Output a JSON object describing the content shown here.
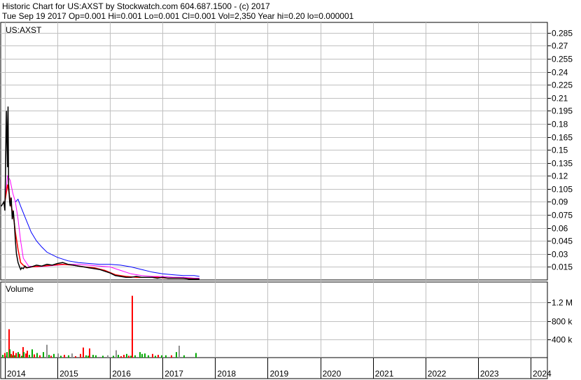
{
  "header": {
    "line1": "Historic Chart for US:AXST by Stockwatch.com 604.687.1500 - (c) 2017",
    "line2": "Tue Sep 19 2017   Op=0.001   Hi=0.001   Lo=0.001   Cl=0.001   Vol=2,350   Year hi=0.20   lo=0.000001"
  },
  "chart_data": {
    "type": "line",
    "symbol": "US:AXST",
    "price_axis": {
      "ticks": [
        "0.285",
        "0.27",
        "0.255",
        "0.24",
        "0.225",
        "0.21",
        "0.195",
        "0.18",
        "0.165",
        "0.15",
        "0.135",
        "0.12",
        "0.105",
        "0.09",
        "0.075",
        "0.06",
        "0.045",
        "0.03",
        "0.015"
      ],
      "ylim": [
        0,
        0.297
      ]
    },
    "volume_panel": {
      "title": "Volume",
      "ticks": [
        "1.2 M",
        "800 k",
        "400 k"
      ],
      "ylim": [
        0,
        1.65
      ]
    },
    "x_axis": {
      "labels": [
        "2014",
        "2015",
        "2016",
        "2017",
        "2018",
        "2019",
        "2020",
        "2021",
        "2022",
        "2023",
        "2024"
      ],
      "xlim": [
        2013.92,
        2024.32
      ]
    },
    "grid": true,
    "colors": {
      "price": "#000000",
      "ma_short": "#ff0000",
      "ma_mid": "#ff00ff",
      "ma_long": "#0000ff",
      "vol_up": "#00aa00",
      "vol_down": "#ff0000",
      "vol_flat": "#909090"
    },
    "price": {
      "x": [
        2013.93,
        2013.98,
        2014.0,
        2014.03,
        2014.05,
        2014.06,
        2014.07,
        2014.09,
        2014.1,
        2014.12,
        2014.14,
        2014.16,
        2014.18,
        2014.2,
        2014.22,
        2014.25,
        2014.28,
        2014.3,
        2014.32,
        2014.35,
        2014.38,
        2014.42,
        2014.5,
        2014.6,
        2014.7,
        2014.8,
        2014.9,
        2015.0,
        2015.1,
        2015.2,
        2015.3,
        2015.4,
        2015.5,
        2015.6,
        2015.7,
        2015.8,
        2015.9,
        2016.0,
        2016.1,
        2016.2,
        2016.3,
        2016.4,
        2016.5,
        2016.6,
        2016.7,
        2016.8,
        2016.9,
        2017.0,
        2017.1,
        2017.2,
        2017.3,
        2017.4,
        2017.5,
        2017.6,
        2017.7
      ],
      "y": [
        0.085,
        0.09,
        0.08,
        0.195,
        0.13,
        0.2,
        0.11,
        0.09,
        0.085,
        0.095,
        0.07,
        0.08,
        0.065,
        0.045,
        0.03,
        0.02,
        0.015,
        0.012,
        0.014,
        0.013,
        0.016,
        0.014,
        0.015,
        0.017,
        0.016,
        0.018,
        0.017,
        0.019,
        0.02,
        0.018,
        0.017,
        0.016,
        0.015,
        0.014,
        0.013,
        0.012,
        0.01,
        0.008,
        0.005,
        0.004,
        0.003,
        0.003,
        0.004,
        0.003,
        0.003,
        0.003,
        0.002,
        0.003,
        0.002,
        0.002,
        0.002,
        0.002,
        0.001,
        0.001,
        0.001
      ]
    },
    "ma_short": {
      "x": [
        2014.0,
        2014.05,
        2014.08,
        2014.12,
        2014.16,
        2014.2,
        2014.25,
        2014.3,
        2014.4,
        2014.5,
        2014.7,
        2014.9,
        2015.1,
        2015.3,
        2015.5,
        2015.7,
        2015.9,
        2016.1,
        2016.3,
        2016.5,
        2016.7,
        2016.9,
        2017.1,
        2017.3,
        2017.5,
        2017.7
      ],
      "y": [
        0.09,
        0.11,
        0.1,
        0.085,
        0.075,
        0.055,
        0.035,
        0.02,
        0.014,
        0.015,
        0.016,
        0.017,
        0.018,
        0.017,
        0.015,
        0.014,
        0.011,
        0.006,
        0.004,
        0.003,
        0.003,
        0.003,
        0.002,
        0.002,
        0.0015,
        0.001
      ]
    },
    "ma_mid": {
      "x": [
        2014.0,
        2014.05,
        2014.1,
        2014.15,
        2014.2,
        2014.25,
        2014.3,
        2014.35,
        2014.45,
        2014.6,
        2014.8,
        2015.0,
        2015.2,
        2015.4,
        2015.6,
        2015.8,
        2016.0,
        2016.2,
        2016.4,
        2016.6,
        2016.8,
        2017.0,
        2017.2,
        2017.4,
        2017.6,
        2017.7
      ],
      "y": [
        0.09,
        0.12,
        0.115,
        0.1,
        0.09,
        0.07,
        0.045,
        0.025,
        0.016,
        0.015,
        0.016,
        0.017,
        0.018,
        0.018,
        0.017,
        0.016,
        0.015,
        0.011,
        0.007,
        0.005,
        0.004,
        0.004,
        0.003,
        0.003,
        0.002,
        0.002
      ]
    },
    "ma_long": {
      "x": [
        2014.2,
        2014.25,
        2014.3,
        2014.4,
        2014.5,
        2014.6,
        2014.7,
        2014.8,
        2015.0,
        2015.2,
        2015.4,
        2015.6,
        2015.8,
        2016.0,
        2016.2,
        2016.4,
        2016.6,
        2016.8,
        2017.0,
        2017.2,
        2017.4,
        2017.6,
        2017.7
      ],
      "y": [
        0.09,
        0.093,
        0.085,
        0.07,
        0.055,
        0.045,
        0.038,
        0.032,
        0.026,
        0.022,
        0.02,
        0.019,
        0.018,
        0.018,
        0.017,
        0.015,
        0.012,
        0.009,
        0.007,
        0.006,
        0.005,
        0.005,
        0.004
      ]
    },
    "volume_bars": [
      {
        "x": 2013.95,
        "v": 0.06,
        "c": "up"
      },
      {
        "x": 2013.98,
        "v": 0.1,
        "c": "down"
      },
      {
        "x": 2014.01,
        "v": 0.04,
        "c": "flat"
      },
      {
        "x": 2014.03,
        "v": 0.12,
        "c": "up"
      },
      {
        "x": 2014.06,
        "v": 0.62,
        "c": "down"
      },
      {
        "x": 2014.08,
        "v": 0.18,
        "c": "up"
      },
      {
        "x": 2014.1,
        "v": 0.08,
        "c": "down"
      },
      {
        "x": 2014.13,
        "v": 0.05,
        "c": "up"
      },
      {
        "x": 2014.15,
        "v": 0.14,
        "c": "down"
      },
      {
        "x": 2014.17,
        "v": 0.05,
        "c": "up"
      },
      {
        "x": 2014.2,
        "v": 0.1,
        "c": "down"
      },
      {
        "x": 2014.24,
        "v": 0.12,
        "c": "up"
      },
      {
        "x": 2014.27,
        "v": 0.08,
        "c": "down"
      },
      {
        "x": 2014.3,
        "v": 0.04,
        "c": "up"
      },
      {
        "x": 2014.33,
        "v": 0.23,
        "c": "down"
      },
      {
        "x": 2014.35,
        "v": 0.12,
        "c": "up"
      },
      {
        "x": 2014.38,
        "v": 0.09,
        "c": "down"
      },
      {
        "x": 2014.41,
        "v": 0.15,
        "c": "down"
      },
      {
        "x": 2014.45,
        "v": 0.06,
        "c": "up"
      },
      {
        "x": 2014.5,
        "v": 0.18,
        "c": "up"
      },
      {
        "x": 2014.55,
        "v": 0.07,
        "c": "down"
      },
      {
        "x": 2014.6,
        "v": 0.1,
        "c": "up"
      },
      {
        "x": 2014.65,
        "v": 0.05,
        "c": "down"
      },
      {
        "x": 2014.72,
        "v": 0.12,
        "c": "up"
      },
      {
        "x": 2014.78,
        "v": 0.28,
        "c": "flat"
      },
      {
        "x": 2014.83,
        "v": 0.06,
        "c": "up"
      },
      {
        "x": 2014.87,
        "v": 0.04,
        "c": "down"
      },
      {
        "x": 2014.92,
        "v": 0.08,
        "c": "up"
      },
      {
        "x": 2015.0,
        "v": 0.09,
        "c": "flat"
      },
      {
        "x": 2015.05,
        "v": 0.04,
        "c": "up"
      },
      {
        "x": 2015.12,
        "v": 0.06,
        "c": "down"
      },
      {
        "x": 2015.2,
        "v": 0.05,
        "c": "up"
      },
      {
        "x": 2015.27,
        "v": 0.09,
        "c": "flat"
      },
      {
        "x": 2015.33,
        "v": 0.03,
        "c": "down"
      },
      {
        "x": 2015.43,
        "v": 0.08,
        "c": "down"
      },
      {
        "x": 2015.48,
        "v": 0.22,
        "c": "down"
      },
      {
        "x": 2015.53,
        "v": 0.05,
        "c": "up"
      },
      {
        "x": 2015.57,
        "v": 0.04,
        "c": "up"
      },
      {
        "x": 2015.6,
        "v": 0.2,
        "c": "down"
      },
      {
        "x": 2015.66,
        "v": 0.06,
        "c": "up"
      },
      {
        "x": 2015.72,
        "v": 0.05,
        "c": "up"
      },
      {
        "x": 2015.85,
        "v": 0.04,
        "c": "up"
      },
      {
        "x": 2015.95,
        "v": 0.05,
        "c": "flat"
      },
      {
        "x": 2016.05,
        "v": 0.04,
        "c": "up"
      },
      {
        "x": 2016.1,
        "v": 0.16,
        "c": "flat"
      },
      {
        "x": 2016.15,
        "v": 0.06,
        "c": "up"
      },
      {
        "x": 2016.2,
        "v": 0.03,
        "c": "down"
      },
      {
        "x": 2016.25,
        "v": 0.06,
        "c": "down"
      },
      {
        "x": 2016.3,
        "v": 0.08,
        "c": "up"
      },
      {
        "x": 2016.34,
        "v": 0.04,
        "c": "down"
      },
      {
        "x": 2016.38,
        "v": 0.04,
        "c": "up"
      },
      {
        "x": 2016.41,
        "v": 1.35,
        "c": "down"
      },
      {
        "x": 2016.46,
        "v": 0.05,
        "c": "up"
      },
      {
        "x": 2016.55,
        "v": 0.12,
        "c": "up"
      },
      {
        "x": 2016.6,
        "v": 0.08,
        "c": "up"
      },
      {
        "x": 2016.65,
        "v": 0.09,
        "c": "up"
      },
      {
        "x": 2016.72,
        "v": 0.05,
        "c": "up"
      },
      {
        "x": 2016.8,
        "v": 0.08,
        "c": "down"
      },
      {
        "x": 2016.85,
        "v": 0.04,
        "c": "up"
      },
      {
        "x": 2016.9,
        "v": 0.06,
        "c": "down"
      },
      {
        "x": 2016.97,
        "v": 0.05,
        "c": "up"
      },
      {
        "x": 2017.05,
        "v": 0.05,
        "c": "up"
      },
      {
        "x": 2017.15,
        "v": 0.05,
        "c": "down"
      },
      {
        "x": 2017.25,
        "v": 0.12,
        "c": "up"
      },
      {
        "x": 2017.3,
        "v": 0.26,
        "c": "flat"
      },
      {
        "x": 2017.4,
        "v": 0.05,
        "c": "up"
      },
      {
        "x": 2017.62,
        "v": 0.1,
        "c": "up"
      }
    ]
  }
}
